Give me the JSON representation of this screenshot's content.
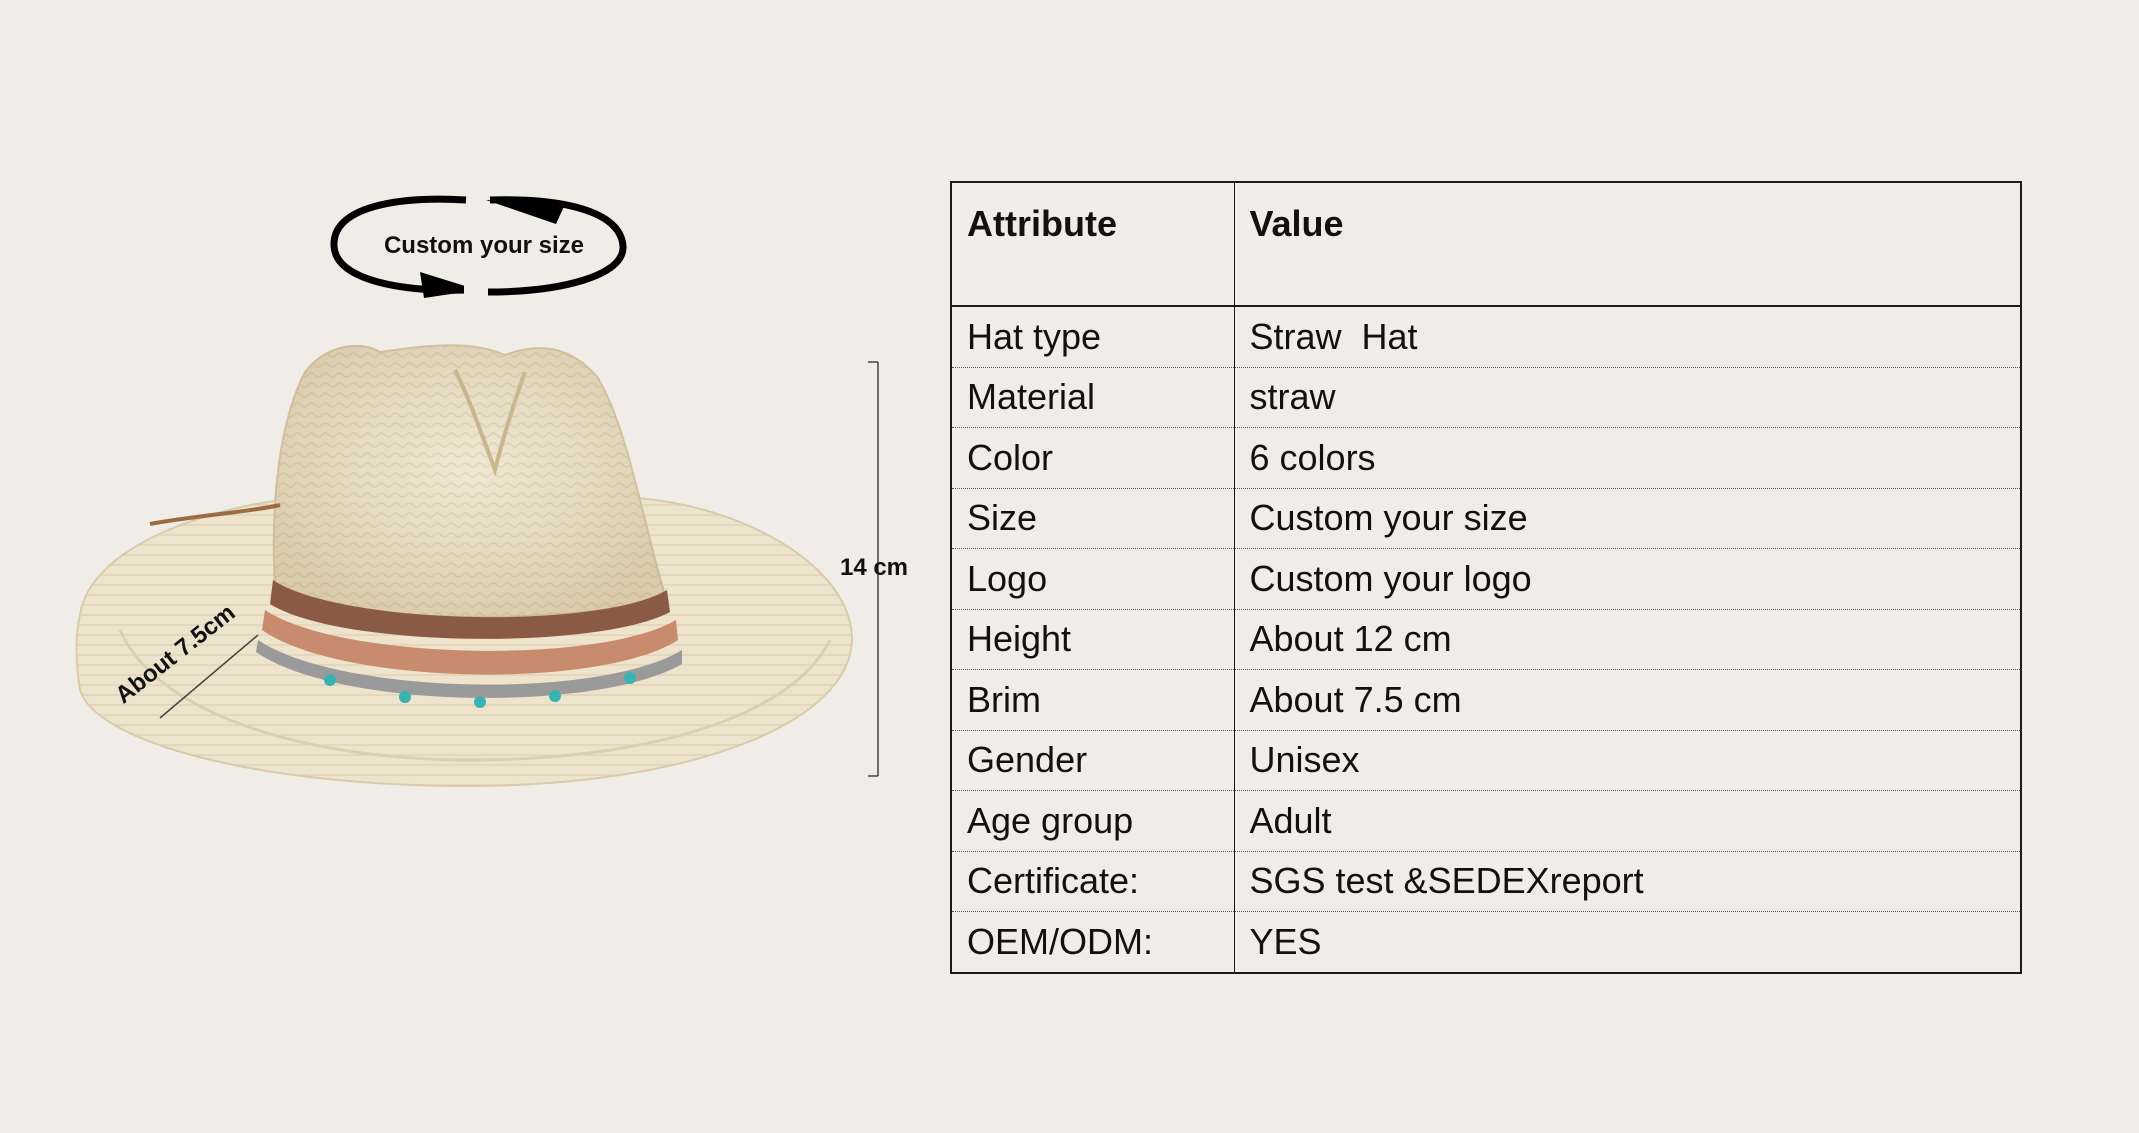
{
  "annotations": {
    "custom_size_label": "Custom your size",
    "height_label": "14 cm",
    "brim_label": "About  7.5cm"
  },
  "table": {
    "header_attribute": "Attribute",
    "header_value": "Value",
    "rows": [
      {
        "attribute": "Hat type",
        "value": "Straw  Hat"
      },
      {
        "attribute": "Material",
        "value": "straw"
      },
      {
        "attribute": "Color",
        "value": "6 colors"
      },
      {
        "attribute": "Size",
        "value": "Custom your size"
      },
      {
        "attribute": "Logo",
        "value": "Custom your logo"
      },
      {
        "attribute": "Height",
        "value": "About 12 cm"
      },
      {
        "attribute": "Brim",
        "value": "About 7.5 cm"
      },
      {
        "attribute": "Gender",
        "value": "Unisex"
      },
      {
        "attribute": "Age group",
        "value": "Adult"
      },
      {
        "attribute": "Certificate:",
        "value": "SGS test &SEDEXreport"
      },
      {
        "attribute": "OEM/ODM:",
        "value": "YES"
      }
    ]
  },
  "colors": {
    "background": "#f0ede8",
    "straw": "#ece0c3",
    "band": "#8a5a44"
  }
}
